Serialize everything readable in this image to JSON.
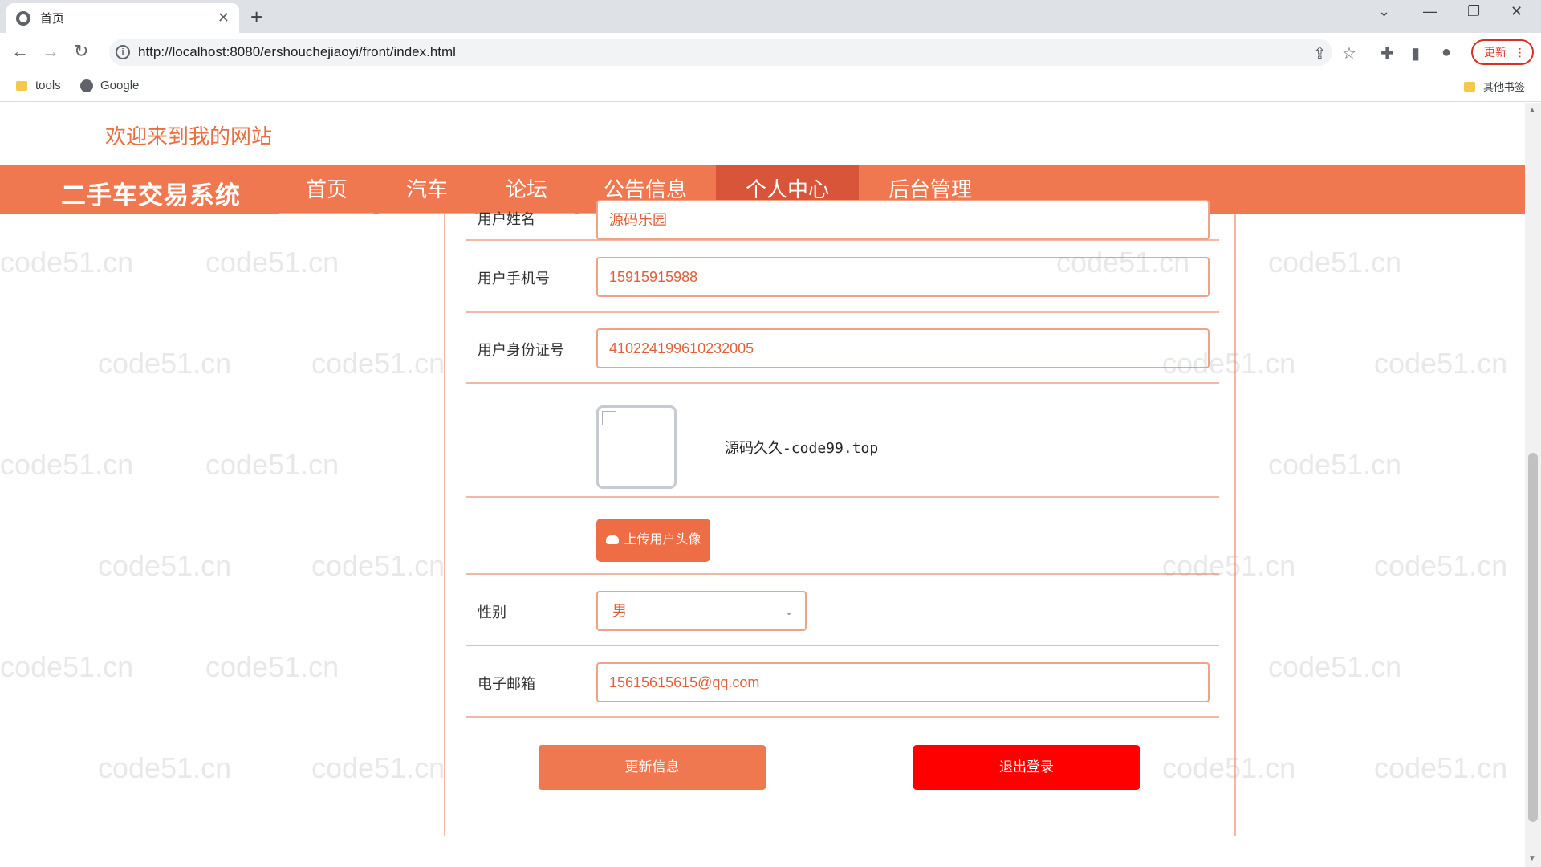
{
  "browser": {
    "tab_title": "首页",
    "url": "http://localhost:8080/ershouchejiaoyi/front/index.html",
    "update_label": "更新",
    "bookmarks": [
      "tools",
      "Google"
    ],
    "other_bookmarks": "其他书签"
  },
  "site": {
    "welcome": "欢迎来到我的网站",
    "brand": "二手车交易系统",
    "nav": [
      "首页",
      "汽车",
      "论坛",
      "公告信息",
      "个人中心",
      "后台管理"
    ],
    "active_nav": "个人中心"
  },
  "form": {
    "name_label": "用户姓名",
    "name_value": "源码乐园",
    "phone_label": "用户手机号",
    "phone_value": "15915915988",
    "id_label": "用户身份证号",
    "id_value": "410224199610232005",
    "avatar_caption": "源码久久-code99.top",
    "upload_label": "上传用户头像",
    "gender_label": "性别",
    "gender_value": "男",
    "email_label": "电子邮箱",
    "email_value": "15615615615@qq.com",
    "update_button": "更新信息",
    "logout_button": "退出登录"
  },
  "watermark_text": "code51.cn"
}
